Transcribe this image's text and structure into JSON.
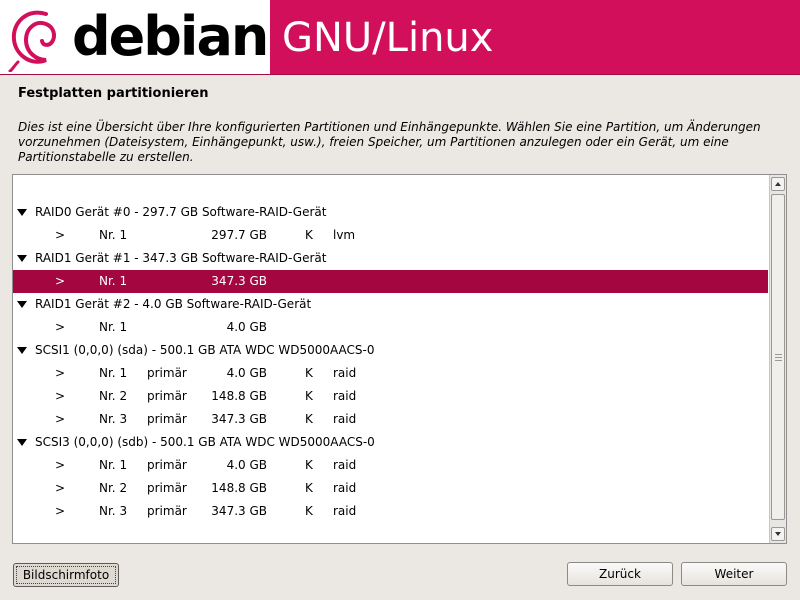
{
  "banner": {
    "wordmark": "debian",
    "tagline": "GNU/Linux"
  },
  "page": {
    "title": "Festplatten partitionieren",
    "description": "Dies ist eine Übersicht über Ihre konfigurierten Partitionen und Einhängepunkte. Wählen Sie eine Partition, um Änderungen vorzunehmen (Dateisystem, Einhängepunkt, usw.), freien Speicher, um Partitionen anzulegen oder ein Gerät, um eine Partitionstabelle zu erstellen."
  },
  "partitions": {
    "rows": [
      {
        "kind": "device",
        "label": "RAID0 Gerät #0 - 297.7 GB Software-RAID-Gerät"
      },
      {
        "kind": "part",
        "arrow": ">",
        "num": "Nr. 1",
        "type": "",
        "size": "297.7 GB",
        "flag": "K",
        "fs": "lvm"
      },
      {
        "kind": "device",
        "label": "RAID1 Gerät #1 - 347.3 GB Software-RAID-Gerät"
      },
      {
        "kind": "part",
        "arrow": ">",
        "num": "Nr. 1",
        "type": "",
        "size": "347.3 GB",
        "flag": "",
        "fs": "",
        "selected": true
      },
      {
        "kind": "device",
        "label": "RAID1 Gerät #2 - 4.0 GB Software-RAID-Gerät"
      },
      {
        "kind": "part",
        "arrow": ">",
        "num": "Nr. 1",
        "type": "",
        "size": "4.0 GB",
        "flag": "",
        "fs": ""
      },
      {
        "kind": "device",
        "label": "SCSI1 (0,0,0) (sda) - 500.1 GB ATA WDC WD5000AACS-0"
      },
      {
        "kind": "part",
        "arrow": ">",
        "num": "Nr. 1",
        "type": "primär",
        "size": "4.0 GB",
        "flag": "K",
        "fs": "raid"
      },
      {
        "kind": "part",
        "arrow": ">",
        "num": "Nr. 2",
        "type": "primär",
        "size": "148.8 GB",
        "flag": "K",
        "fs": "raid"
      },
      {
        "kind": "part",
        "arrow": ">",
        "num": "Nr. 3",
        "type": "primär",
        "size": "347.3 GB",
        "flag": "K",
        "fs": "raid"
      },
      {
        "kind": "device",
        "label": "SCSI3 (0,0,0) (sdb) - 500.1 GB ATA WDC WD5000AACS-0"
      },
      {
        "kind": "part",
        "arrow": ">",
        "num": "Nr. 1",
        "type": "primär",
        "size": "4.0 GB",
        "flag": "K",
        "fs": "raid"
      },
      {
        "kind": "part",
        "arrow": ">",
        "num": "Nr. 2",
        "type": "primär",
        "size": "148.8 GB",
        "flag": "K",
        "fs": "raid"
      },
      {
        "kind": "part",
        "arrow": ">",
        "num": "Nr. 3",
        "type": "primär",
        "size": "347.3 GB",
        "flag": "K",
        "fs": "raid"
      }
    ]
  },
  "buttons": {
    "screenshot": "Bildschirmfoto",
    "back": "Zurück",
    "next": "Weiter"
  },
  "colors": {
    "banner": "#d20f5a",
    "selection": "#a4063f"
  }
}
